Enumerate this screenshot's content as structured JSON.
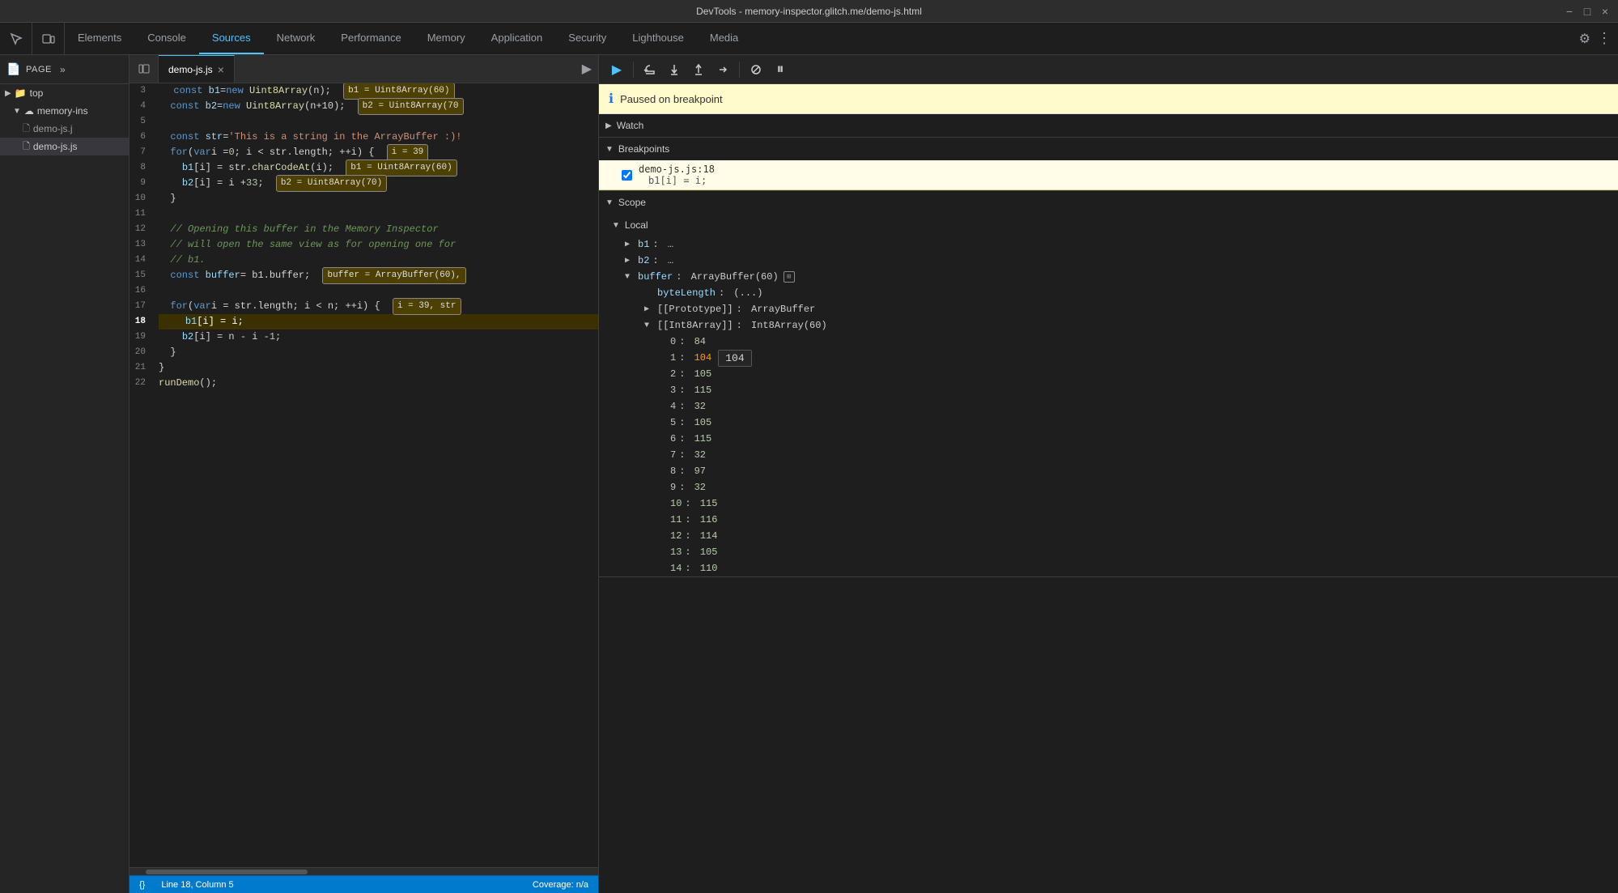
{
  "titleBar": {
    "title": "DevTools - memory-inspector.glitch.me/demo-js.html",
    "minimize": "−",
    "maximize": "□",
    "close": "×"
  },
  "tabs": {
    "items": [
      {
        "label": "Elements",
        "active": false
      },
      {
        "label": "Console",
        "active": false
      },
      {
        "label": "Sources",
        "active": true
      },
      {
        "label": "Network",
        "active": false
      },
      {
        "label": "Performance",
        "active": false
      },
      {
        "label": "Memory",
        "active": false
      },
      {
        "label": "Application",
        "active": false
      },
      {
        "label": "Security",
        "active": false
      },
      {
        "label": "Lighthouse",
        "active": false
      },
      {
        "label": "Media",
        "active": false
      }
    ]
  },
  "sidebar": {
    "header": "Page",
    "tree": [
      {
        "label": "top",
        "level": 0,
        "icon": "▶",
        "type": "folder"
      },
      {
        "label": "memory-ins",
        "level": 1,
        "icon": "☁",
        "type": "folder"
      },
      {
        "label": "demo-js.j",
        "level": 2,
        "icon": "📄",
        "type": "file"
      },
      {
        "label": "demo-js.js",
        "level": 2,
        "icon": "📄",
        "type": "file",
        "selected": true
      }
    ]
  },
  "fileTab": {
    "name": "demo-js.js",
    "active": true
  },
  "code": {
    "lines": [
      {
        "num": 3,
        "content": "  const b1 = new Uint8Array(n);  b1 = Uint8Array(60)"
      },
      {
        "num": 4,
        "content": "  const b2 = new Uint8Array(n+10);  b2 = Uint8Array(70"
      },
      {
        "num": 5,
        "content": ""
      },
      {
        "num": 6,
        "content": "  const str = 'This is a string in the ArrayBuffer :)!"
      },
      {
        "num": 7,
        "content": "  for (var i = 0; i < str.length; ++i) {  i = 39"
      },
      {
        "num": 8,
        "content": "    b1[i] = str.charCodeAt(i);  b1 = Uint8Array(60)"
      },
      {
        "num": 9,
        "content": "    b2[i] = i + 33;  b2 = Uint8Array(70)"
      },
      {
        "num": 10,
        "content": "  }"
      },
      {
        "num": 11,
        "content": ""
      },
      {
        "num": 12,
        "content": "  // Opening this buffer in the Memory Inspector"
      },
      {
        "num": 13,
        "content": "  // will open the same view as for opening one for"
      },
      {
        "num": 14,
        "content": "  // b1."
      },
      {
        "num": 15,
        "content": "  const buffer = b1.buffer;  buffer = ArrayBuffer(60),"
      },
      {
        "num": 16,
        "content": ""
      },
      {
        "num": 17,
        "content": "  for (var i = str.length; i < n; ++i) {  i = 39, str"
      },
      {
        "num": 18,
        "content": "    b1[i] = i;",
        "highlighted": true
      },
      {
        "num": 19,
        "content": "    b2[i] = n - i - 1;"
      },
      {
        "num": 20,
        "content": "  }"
      },
      {
        "num": 21,
        "content": "}"
      },
      {
        "num": 22,
        "content": "runDemo();"
      }
    ]
  },
  "status": {
    "position": "Line 18, Column 5",
    "coverage": "Coverage: n/a"
  },
  "debugger": {
    "breakpointInfo": "Paused on breakpoint",
    "sections": {
      "watch": "Watch",
      "breakpoints": "Breakpoints",
      "scope": "Scope",
      "local": "Local"
    },
    "breakpoint": {
      "file": "demo-js.js:18",
      "code": "b1[i] = i;"
    },
    "scope": {
      "b1": "…",
      "b2": "…",
      "buffer": "ArrayBuffer(60)",
      "byteLength": "(...)",
      "prototype": "ArrayBuffer",
      "int8Array": "Int8Array(60)",
      "entries": [
        {
          "index": 0,
          "value": "84"
        },
        {
          "index": 1,
          "value": "104"
        },
        {
          "index": 2,
          "value": "105"
        },
        {
          "index": 3,
          "value": "115"
        },
        {
          "index": 4,
          "value": "32"
        },
        {
          "index": 5,
          "value": "105"
        },
        {
          "index": 6,
          "value": "115"
        },
        {
          "index": 7,
          "value": "32"
        },
        {
          "index": 8,
          "value": "97"
        },
        {
          "index": 9,
          "value": "32"
        },
        {
          "index": 10,
          "value": "115"
        },
        {
          "index": 11,
          "value": "116"
        },
        {
          "index": 12,
          "value": "114"
        },
        {
          "index": 13,
          "value": "105"
        },
        {
          "index": 14,
          "value": "110"
        }
      ],
      "tooltip": "104"
    }
  },
  "icons": {
    "resume": "▶",
    "stepOver": "↷",
    "stepInto": "↓",
    "stepOut": "↑",
    "stepBack": "←",
    "deactivate": "⊘",
    "pause": "⏸",
    "settings": "⚙",
    "more": "⋮",
    "expand": "▶",
    "collapse": "▼",
    "chevronRight": "›",
    "dot": "●",
    "file": "📄",
    "folder": "📁",
    "cloud": "☁"
  }
}
